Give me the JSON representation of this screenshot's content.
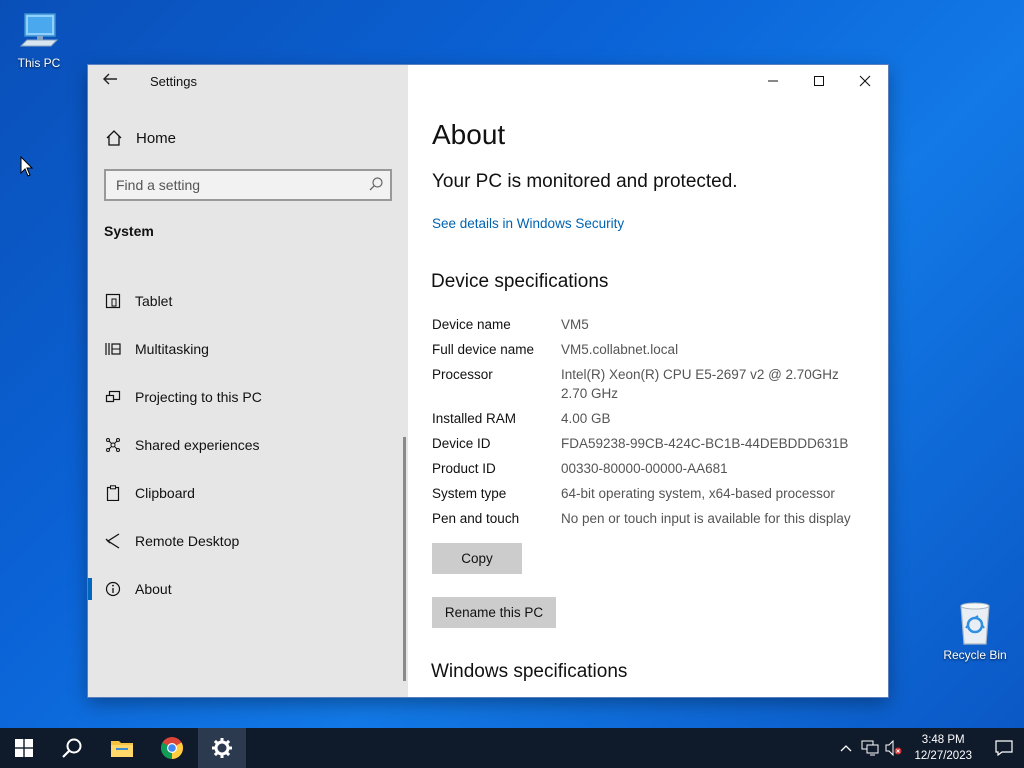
{
  "desktop": {
    "this_pc_label": "This PC",
    "recycle_label": "Recycle Bin"
  },
  "window": {
    "title": "Settings"
  },
  "sidebar": {
    "home_label": "Home",
    "search_placeholder": "Find a setting",
    "section": "System",
    "items": [
      {
        "label": "Tablet",
        "icon": "tablet-icon"
      },
      {
        "label": "Multitasking",
        "icon": "multitasking-icon"
      },
      {
        "label": "Projecting to this PC",
        "icon": "projecting-icon"
      },
      {
        "label": "Shared experiences",
        "icon": "shared-experiences-icon"
      },
      {
        "label": "Clipboard",
        "icon": "clipboard-icon"
      },
      {
        "label": "Remote Desktop",
        "icon": "remote-desktop-icon"
      },
      {
        "label": "About",
        "icon": "info-icon",
        "active": true
      }
    ]
  },
  "content": {
    "title": "About",
    "protection_status": "Your PC is monitored and protected.",
    "security_link": "See details in Windows Security",
    "device_specs_heading": "Device specifications",
    "specs": [
      {
        "key": "Device name",
        "value": "VM5"
      },
      {
        "key": "Full device name",
        "value": "VM5.collabnet.local"
      },
      {
        "key": "Processor",
        "value": "Intel(R) Xeon(R) CPU E5-2697 v2 @ 2.70GHz",
        "value2": "2.70 GHz"
      },
      {
        "key": "Installed RAM",
        "value": "4.00 GB"
      },
      {
        "key": "Device ID",
        "value": "FDA59238-99CB-424C-BC1B-44DEBDDD631B"
      },
      {
        "key": "Product ID",
        "value": "00330-80000-00000-AA681"
      },
      {
        "key": "System type",
        "value": "64-bit operating system, x64-based processor"
      },
      {
        "key": "Pen and touch",
        "value": "No pen or touch input is available for this display"
      }
    ],
    "copy_label": "Copy",
    "rename_label": "Rename this PC",
    "windows_specs_heading": "Windows specifications"
  },
  "taskbar": {
    "time": "3:48 PM",
    "date": "12/27/2023"
  },
  "colors": {
    "accent": "#0067c0",
    "link": "#0063b1",
    "taskbar": "#0f1a2b"
  }
}
